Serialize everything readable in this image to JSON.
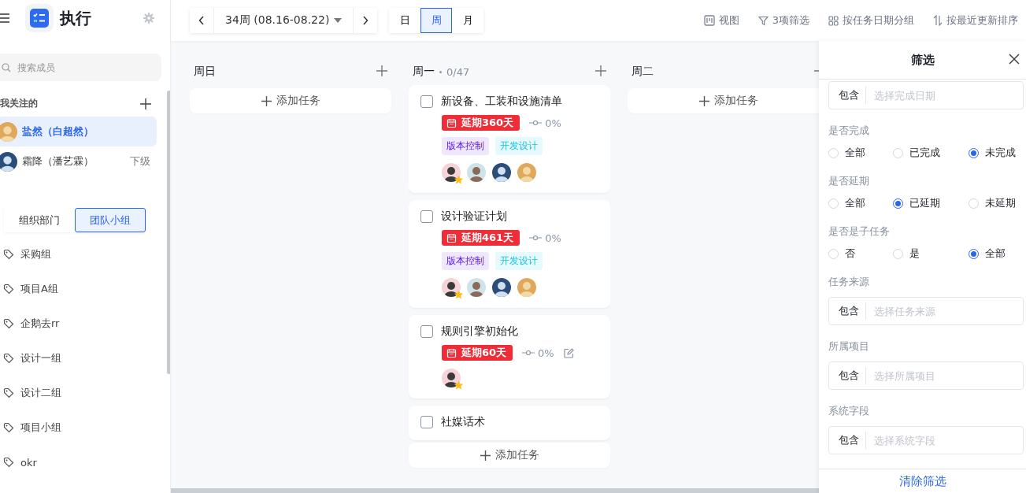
{
  "sidebar": {
    "title": "执行",
    "search": {
      "placeholder": "搜索成员"
    },
    "following_label": "我关注的",
    "members": [
      {
        "name": "盐然（白超然）",
        "selected": true
      },
      {
        "name": "霜降（潘艺霖）",
        "badge": "下级",
        "selected": false
      }
    ],
    "tabs": [
      {
        "label": "组织部门",
        "selected": false
      },
      {
        "label": "团队小组",
        "selected": true
      }
    ],
    "groups": [
      "采购组",
      "项目A组",
      "企鹅去rr",
      "设计一组",
      "设计二组",
      "项目小组",
      "okr"
    ]
  },
  "toolbar": {
    "week": "34周 (08.16-08.22)",
    "views": [
      {
        "label": "日",
        "selected": false
      },
      {
        "label": "周",
        "selected": true
      },
      {
        "label": "月",
        "selected": false
      }
    ],
    "actions": [
      {
        "kind": "view",
        "label": "视图"
      },
      {
        "kind": "filter",
        "label": "3项筛选"
      },
      {
        "kind": "group",
        "label": "按任务日期分组"
      },
      {
        "kind": "sort",
        "label": "按最近更新排序"
      }
    ]
  },
  "board": {
    "columns": [
      {
        "title": "周日",
        "add_label": "添加任务"
      },
      {
        "title": "周一",
        "count": "0/47",
        "add_label": "添加任务",
        "tasks": [
          {
            "title": "新设备、工装和设施清单",
            "checked": false,
            "editable": false,
            "delay": "延期360天",
            "progress": "0%",
            "tags": [
              {
                "label": "版本控制",
                "color": "#efe8fd"
              },
              {
                "label": "开发设计",
                "color": "#e6fafd"
              }
            ],
            "assignees": [
              {
                "owner": true
              },
              {
                "owner": false
              },
              {
                "owner": false
              },
              {
                "owner": false
              }
            ]
          },
          {
            "title": "设计验证计划",
            "checked": false,
            "editable": false,
            "delay": "延期461天",
            "progress": "0%",
            "tags": [
              {
                "label": "版本控制",
                "color": "#efe8fd"
              },
              {
                "label": "开发设计",
                "color": "#e6fafd"
              }
            ],
            "assignees": [
              {
                "owner": true
              },
              {
                "owner": false
              },
              {
                "owner": false
              },
              {
                "owner": false
              }
            ]
          },
          {
            "title": "规则引擎初始化",
            "checked": false,
            "delay": "延期60天",
            "progress": "0%",
            "editable": true,
            "assignees": [
              {
                "owner": true
              }
            ]
          },
          {
            "title": "社媒话术",
            "checked": false
          }
        ]
      },
      {
        "title": "周二",
        "add_label": "添加任务"
      }
    ]
  },
  "filter_panel": {
    "title": "筛选",
    "sections": [
      {
        "kind": "select",
        "prefix": "包含",
        "placeholder": "选择完成日期"
      },
      {
        "kind": "radio",
        "label": "是否完成",
        "options": [
          {
            "label": "全部",
            "selected": false
          },
          {
            "label": "已完成",
            "selected": false
          },
          {
            "label": "未完成",
            "selected": true
          }
        ]
      },
      {
        "kind": "radio",
        "label": "是否延期",
        "options": [
          {
            "label": "全部",
            "selected": false
          },
          {
            "label": "已延期",
            "selected": true
          },
          {
            "label": "未延期",
            "selected": false
          }
        ]
      },
      {
        "kind": "radio",
        "label": "是否是子任务",
        "options": [
          {
            "label": "否",
            "selected": false
          },
          {
            "label": "是",
            "selected": false
          },
          {
            "label": "全部",
            "selected": true
          }
        ]
      },
      {
        "kind": "select",
        "label": "任务来源",
        "prefix": "包含",
        "placeholder": "选择任务来源"
      },
      {
        "kind": "select",
        "label": "所属项目",
        "prefix": "包含",
        "placeholder": "选择所属项目"
      },
      {
        "kind": "select",
        "label": "系统字段",
        "prefix": "包含",
        "placeholder": "选择系统字段"
      }
    ],
    "clear": "清除筛选"
  }
}
